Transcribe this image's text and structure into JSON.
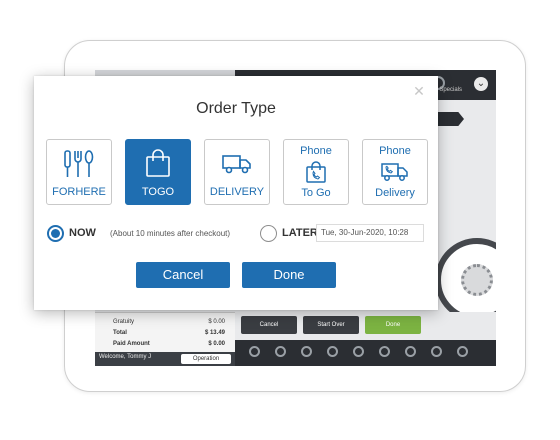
{
  "background_pos": {
    "summary": [
      {
        "label": "Gratuity",
        "value": "$ 0.00"
      },
      {
        "label": "Total",
        "value": "$ 13.49"
      },
      {
        "label": "Paid Amount",
        "value": "$ 0.00"
      }
    ],
    "welcome": "Welcome, Tommy J",
    "operation_button": "Operation",
    "actions": {
      "cancel": "Cancel",
      "start_over": "Start Over",
      "done": "Done"
    },
    "specials_label": "Specials",
    "colors": {
      "action_green": "#7cb342",
      "dark_bar": "#2b2e33"
    }
  },
  "dialog": {
    "title": "Order Type",
    "order_types": [
      {
        "id": "forhere",
        "label": "FORHERE",
        "icon": "utensils-icon",
        "selected": false
      },
      {
        "id": "togo",
        "label": "TOGO",
        "icon": "shopping-bag-icon",
        "selected": true
      },
      {
        "id": "delivery",
        "label": "DELIVERY",
        "icon": "truck-icon",
        "selected": false
      },
      {
        "id": "phone_togo",
        "label_top": "Phone",
        "label": "To Go",
        "icon": "phone-bag-icon",
        "selected": false
      },
      {
        "id": "phone_delivery",
        "label_top": "Phone",
        "label": "Delivery",
        "icon": "phone-truck-icon",
        "selected": false
      }
    ],
    "timing": {
      "now_label": "NOW",
      "now_note": "(About 10 minutes after checkout)",
      "now_selected": true,
      "later_label": "LATER",
      "later_value": "Tue, 30-Jun-2020, 10:28"
    },
    "buttons": {
      "cancel": "Cancel",
      "done": "Done"
    },
    "colors": {
      "accent": "#1f6eb1"
    }
  }
}
